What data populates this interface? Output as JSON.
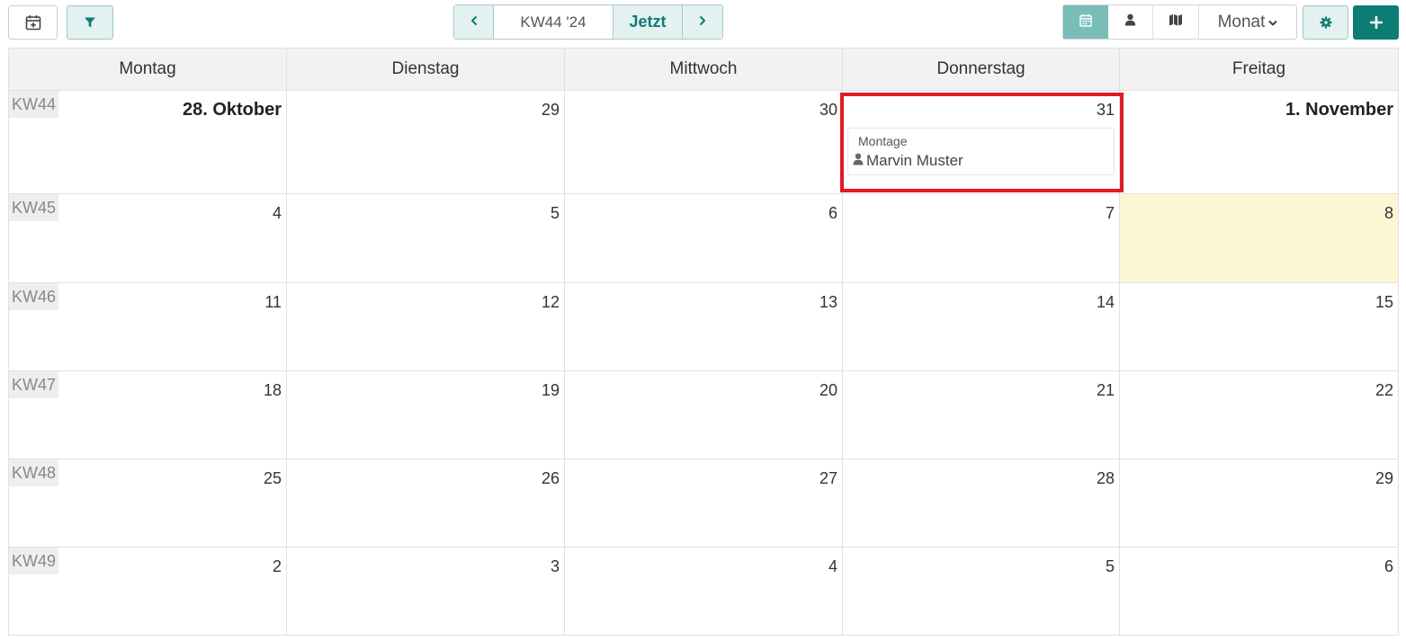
{
  "toolbar": {
    "left": {
      "add_date_icon": "calendar-plus-icon",
      "filter_icon": "filter-icon"
    },
    "nav": {
      "prev_icon": "chevron-left-icon",
      "week_label": "KW44 '24",
      "now_label": "Jetzt",
      "next_icon": "chevron-right-icon"
    },
    "view": {
      "calendar_icon": "calendar-icon",
      "person_icon": "person-icon",
      "map_icon": "map-icon",
      "mode_label": "Monat",
      "settings_icon": "gear-icon",
      "add_icon": "plus-icon"
    }
  },
  "calendar": {
    "weekdays": [
      "Montag",
      "Dienstag",
      "Mittwoch",
      "Donnerstag",
      "Freitag"
    ],
    "weeks": [
      {
        "kw": "KW44",
        "days": [
          "28. Oktober",
          "29",
          "30",
          "31",
          "1. November"
        ]
      },
      {
        "kw": "KW45",
        "days": [
          "4",
          "5",
          "6",
          "7",
          "8"
        ]
      },
      {
        "kw": "KW46",
        "days": [
          "11",
          "12",
          "13",
          "14",
          "15"
        ]
      },
      {
        "kw": "KW47",
        "days": [
          "18",
          "19",
          "20",
          "21",
          "22"
        ]
      },
      {
        "kw": "KW48",
        "days": [
          "25",
          "26",
          "27",
          "28",
          "29"
        ]
      },
      {
        "kw": "KW49",
        "days": [
          "2",
          "3",
          "4",
          "5",
          "6"
        ]
      }
    ],
    "event": {
      "type": "Montage",
      "person": "Marvin Muster"
    }
  },
  "colors": {
    "accent": "#0d7c74",
    "today_bg": "#fcf6d4",
    "highlight": "#e01b24"
  }
}
